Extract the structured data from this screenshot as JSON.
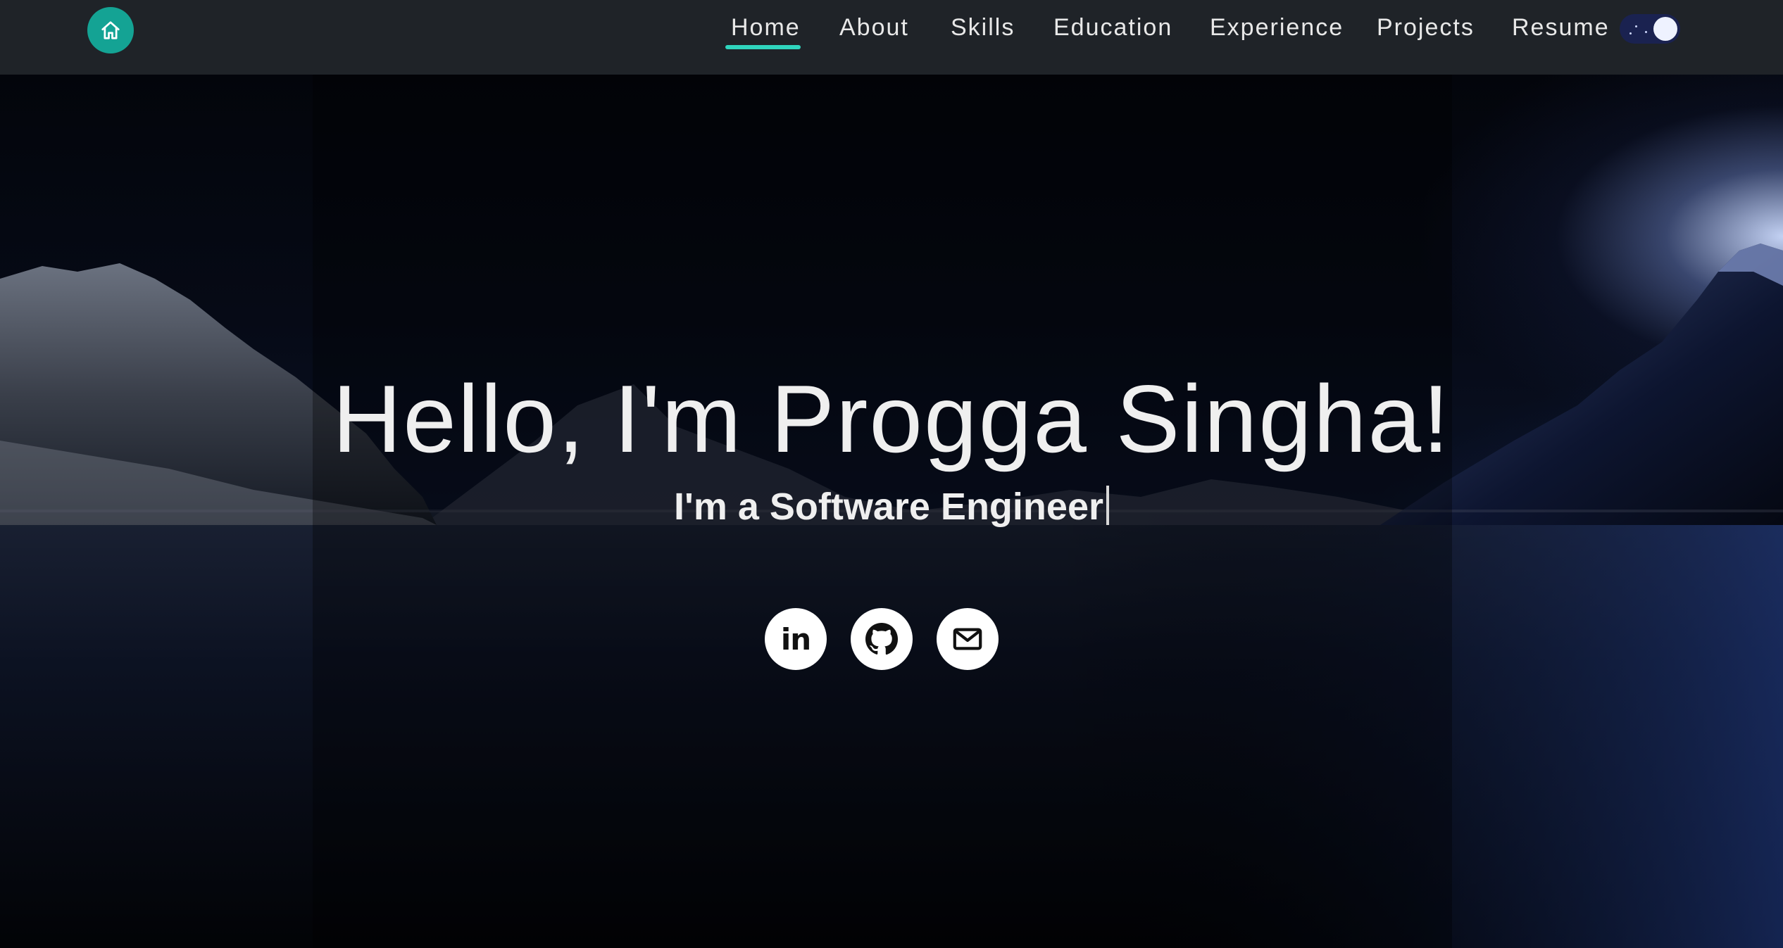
{
  "nav": {
    "home_icon": "home-icon",
    "accent": "#14a394",
    "active_underline": "#2fd5bd",
    "links": [
      {
        "label": "Home",
        "active": true
      },
      {
        "label": "About",
        "active": false
      },
      {
        "label": "Skills",
        "active": false
      },
      {
        "label": "Education",
        "active": false
      },
      {
        "label": "Experience",
        "active": false
      },
      {
        "label": "Projects",
        "active": false
      },
      {
        "label": "Resume",
        "active": false
      }
    ],
    "theme_toggle": {
      "state": "dark",
      "icon": "moon-toggle-icon"
    }
  },
  "hero": {
    "headline": "Hello, I'm Progga Singha!",
    "subline": "I'm a Software Engineer",
    "socials": [
      {
        "name": "LinkedIn",
        "icon": "linkedin-icon",
        "glyph": "in"
      },
      {
        "name": "GitHub",
        "icon": "github-icon"
      },
      {
        "name": "Email",
        "icon": "mail-icon"
      }
    ]
  }
}
